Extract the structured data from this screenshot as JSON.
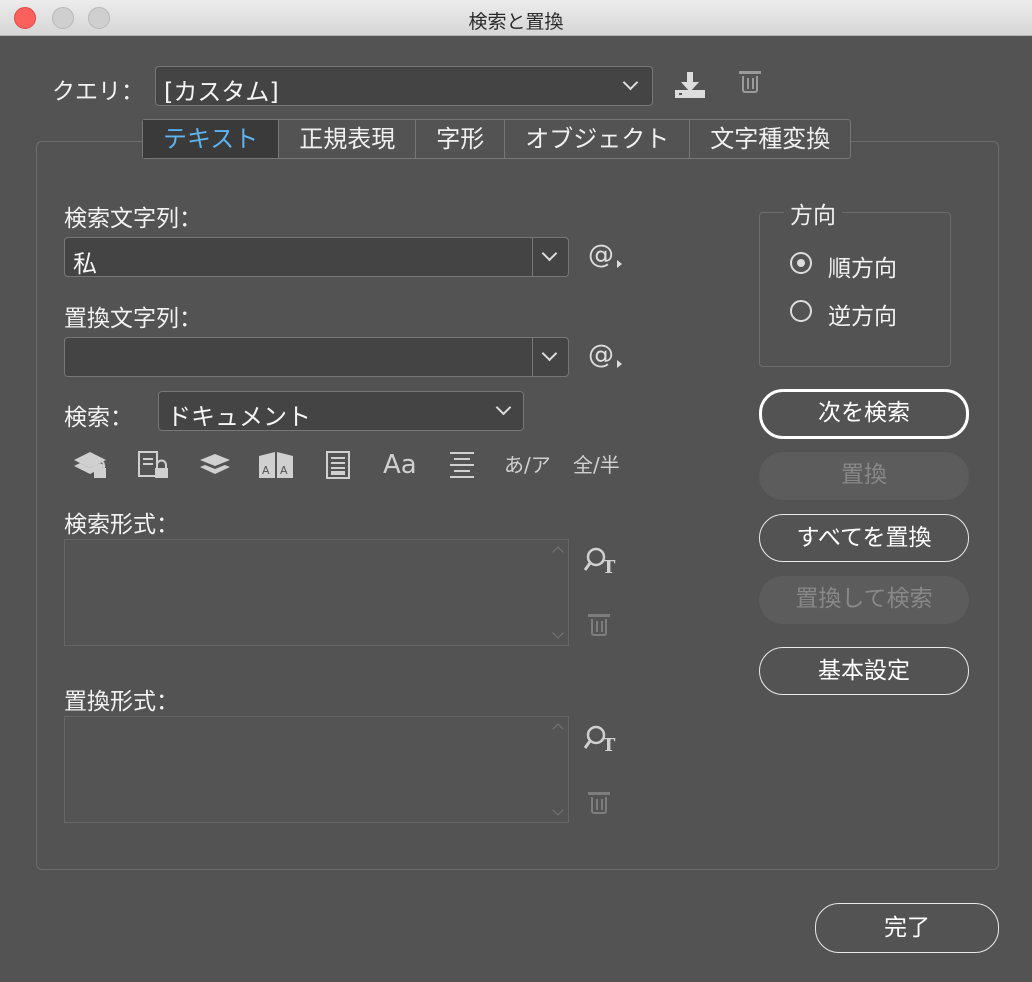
{
  "window": {
    "title": "検索と置換"
  },
  "query": {
    "label": "クエリ：",
    "value": "[カスタム]"
  },
  "tabs": [
    {
      "label": "テキスト",
      "active": true
    },
    {
      "label": "正規表現"
    },
    {
      "label": "字形"
    },
    {
      "label": "オブジェクト"
    },
    {
      "label": "文字種変換"
    }
  ],
  "find": {
    "label": "検索文字列：",
    "value": "私",
    "special_char_icon": "@"
  },
  "change": {
    "label": "置換文字列：",
    "value": "",
    "special_char_icon": "@"
  },
  "search": {
    "label": "検索：",
    "value": "ドキュメント"
  },
  "options": {
    "case_icon": "Aa",
    "kana_icon": "あ/ア",
    "width_icon": "全/半"
  },
  "find_format": {
    "label": "検索形式："
  },
  "change_format": {
    "label": "置換形式："
  },
  "direction": {
    "title": "方向",
    "options": [
      {
        "label": "順方向",
        "selected": true
      },
      {
        "label": "逆方向",
        "selected": false
      }
    ]
  },
  "buttons": {
    "find_next": "次を検索",
    "change": "置換",
    "change_all": "すべてを置換",
    "change_find": "置換して検索",
    "fewer_options": "基本設定",
    "done": "完了"
  }
}
